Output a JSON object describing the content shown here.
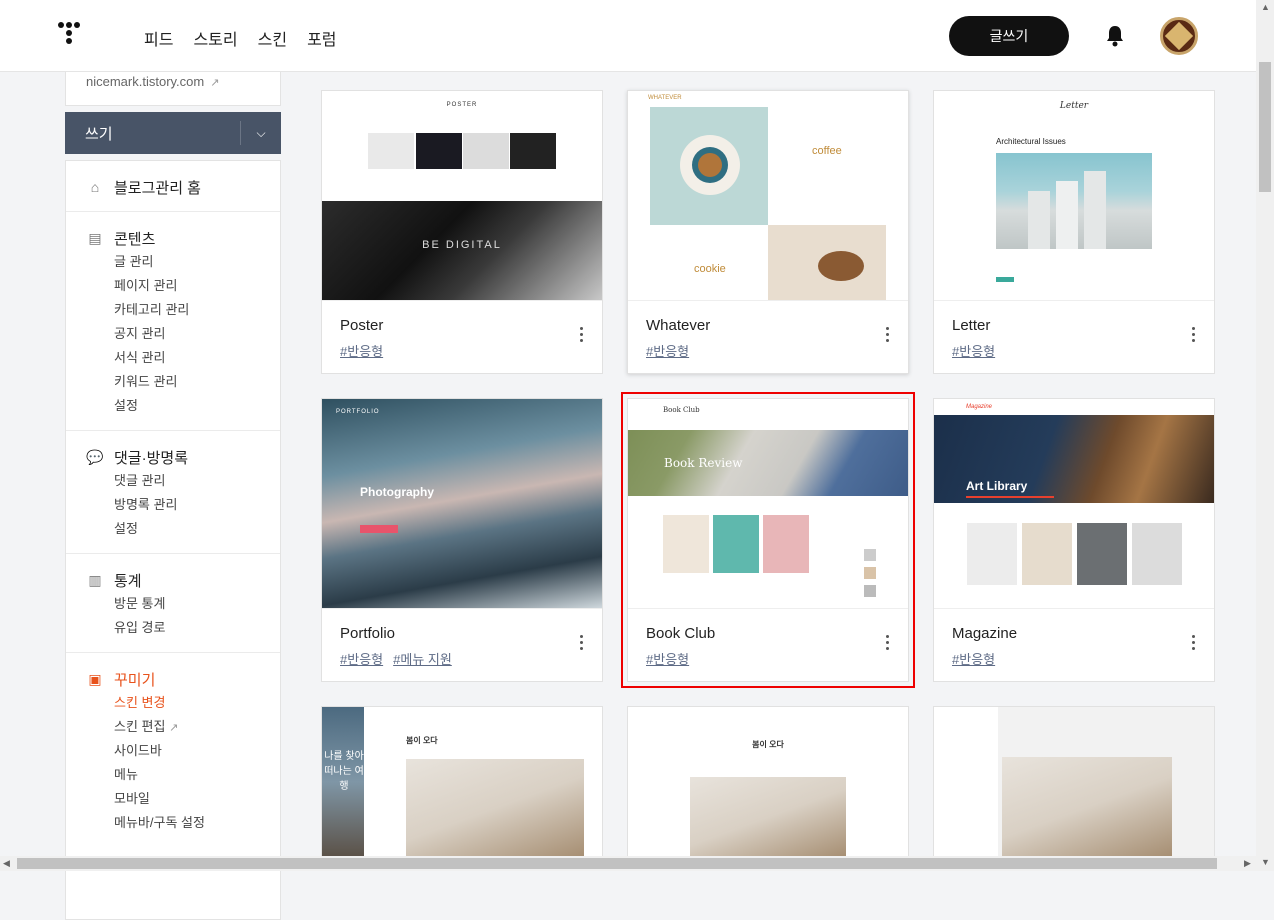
{
  "nav": {
    "items": [
      "피드",
      "스토리",
      "스킨",
      "포럼"
    ],
    "write_label": "글쓰기"
  },
  "sidebar": {
    "blog_url": "nicemark.tistory.com",
    "write_label": "쓰기",
    "sections": [
      {
        "title": "블로그관리 홈",
        "icon": "home-icon",
        "items": []
      },
      {
        "title": "콘텐츠",
        "icon": "document-icon",
        "items": [
          "글 관리",
          "페이지 관리",
          "카테고리 관리",
          "공지 관리",
          "서식 관리",
          "키워드 관리",
          "설정"
        ]
      },
      {
        "title": "댓글·방명록",
        "icon": "comment-icon",
        "items": [
          "댓글 관리",
          "방명록 관리",
          "설정"
        ]
      },
      {
        "title": "통계",
        "icon": "chart-icon",
        "items": [
          "방문 통계",
          "유입 경로"
        ]
      },
      {
        "title": "꾸미기",
        "icon": "layout-icon",
        "items": [
          "스킨 변경",
          "스킨 편집",
          "사이드바",
          "메뉴",
          "모바일",
          "메뉴바/구독 설정"
        ]
      }
    ]
  },
  "skins": [
    {
      "name": "Poster",
      "tags": [
        "#반응형"
      ]
    },
    {
      "name": "Whatever",
      "tags": [
        "#반응형"
      ]
    },
    {
      "name": "Letter",
      "tags": [
        "#반응형"
      ]
    },
    {
      "name": "Portfolio",
      "tags": [
        "#반응형",
        "#메뉴 지원"
      ]
    },
    {
      "name": "Book Club",
      "tags": [
        "#반응형"
      ]
    },
    {
      "name": "Magazine",
      "tags": [
        "#반응형"
      ]
    }
  ],
  "thumb_text": {
    "poster_title": "POSTER",
    "poster_banner": "BE DIGITAL",
    "whatever_title": "WHATEVER",
    "whatever_coffee": "coffee",
    "whatever_cookie": "cookie",
    "letter_title": "Letter",
    "letter_heading": "Architectural Issues",
    "portfolio_title": "PORTFOLIO",
    "portfolio_heading": "Photography",
    "bookclub_title": "Book Club",
    "bookclub_banner": "Book Review",
    "magazine_title": "Magazine",
    "magazine_banner": "Art Library",
    "row3_travel": "나를 찾아 떠나는 여행",
    "row3_spring": "봄이 오다",
    "row3_spring2": "봄이 오다"
  }
}
